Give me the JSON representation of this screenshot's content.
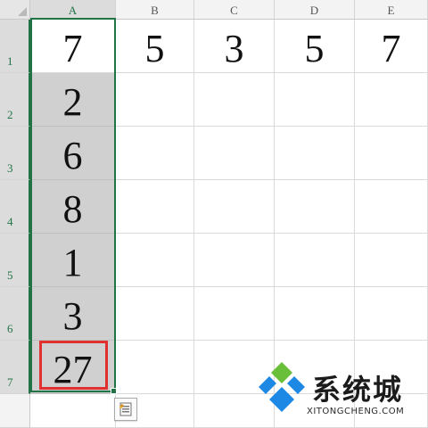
{
  "spreadsheet": {
    "columns": [
      "A",
      "B",
      "C",
      "D",
      "E"
    ],
    "rows": [
      "1",
      "2",
      "3",
      "4",
      "5",
      "6",
      "7"
    ],
    "cells": {
      "A1": "7",
      "B1": "5",
      "C1": "3",
      "D1": "5",
      "E1": "7",
      "A2": "2",
      "A3": "6",
      "A4": "8",
      "A5": "1",
      "A6": "3",
      "A7": "27"
    },
    "selected_range": "A1:A7",
    "active_cell": "A7",
    "colors": {
      "selection": "#217346",
      "active_cell_highlight": "#e03030",
      "shaded_fill": "#d0d0d0"
    }
  },
  "quick_analysis": {
    "icon": "quick-analysis-icon"
  },
  "watermark": {
    "text": "系统城",
    "url": "XITONGCHENG.COM",
    "icon": "watermark-logo-icon",
    "colors": {
      "blue": "#1e88e5",
      "green": "#6abf3a"
    }
  }
}
